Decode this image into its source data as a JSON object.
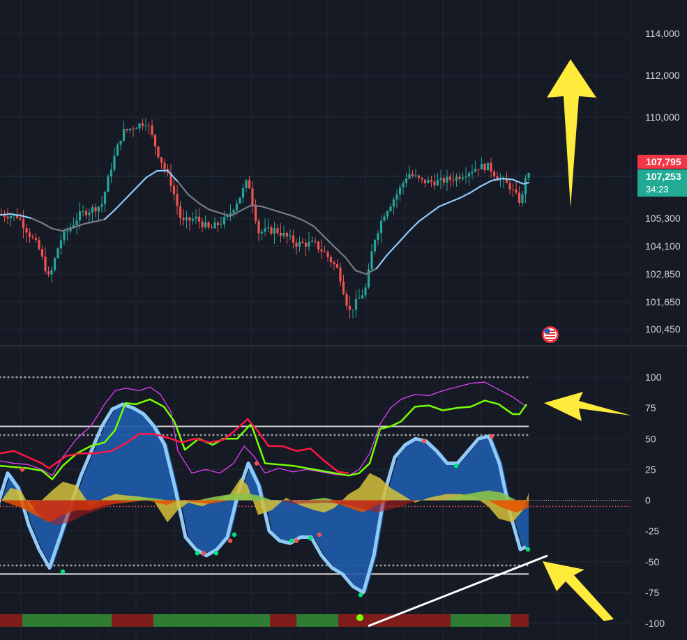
{
  "chart_data": [
    {
      "type": "candlestick",
      "price_axis": {
        "ticks": [
          "114,000",
          "112,000",
          "110,000",
          "105,300",
          "104,100",
          "102,850",
          "101,650",
          "100,450"
        ],
        "tick_values": [
          114000,
          112000,
          110000,
          105300,
          104100,
          102850,
          101650,
          100450
        ]
      },
      "last_high_label": "107,795",
      "last_price_label": "107,253",
      "countdown_label": "34:23",
      "last_price": 107253,
      "last_high": 107795,
      "colors": {
        "up": "#26a69a",
        "down": "#ef5350",
        "ma_light": "#90caf9",
        "ma_gray": "#787b86",
        "annotation": "#ffeb3b"
      },
      "moving_average": [
        [
          0,
          105450
        ],
        [
          15,
          105500
        ],
        [
          30,
          105420
        ],
        [
          45,
          105300
        ],
        [
          60,
          105100
        ],
        [
          75,
          104850
        ],
        [
          90,
          104750
        ],
        [
          105,
          104900
        ],
        [
          120,
          105050
        ],
        [
          135,
          105150
        ],
        [
          150,
          105250
        ],
        [
          165,
          105700
        ],
        [
          180,
          106200
        ],
        [
          195,
          106700
        ],
        [
          210,
          107200
        ],
        [
          225,
          107500
        ],
        [
          240,
          107520
        ],
        [
          255,
          107000
        ],
        [
          270,
          106400
        ],
        [
          285,
          106000
        ],
        [
          300,
          105700
        ],
        [
          315,
          105550
        ],
        [
          330,
          105400
        ],
        [
          345,
          105650
        ],
        [
          360,
          105900
        ],
        [
          375,
          105850
        ],
        [
          390,
          105700
        ],
        [
          405,
          105550
        ],
        [
          420,
          105400
        ],
        [
          435,
          105200
        ],
        [
          450,
          104950
        ],
        [
          465,
          104500
        ],
        [
          480,
          104050
        ],
        [
          495,
          103600
        ],
        [
          510,
          103000
        ],
        [
          525,
          102850
        ],
        [
          540,
          103100
        ],
        [
          555,
          103700
        ],
        [
          570,
          104200
        ],
        [
          585,
          104700
        ],
        [
          600,
          105150
        ],
        [
          615,
          105500
        ],
        [
          630,
          105850
        ],
        [
          645,
          106050
        ],
        [
          660,
          106250
        ],
        [
          675,
          106500
        ],
        [
          690,
          106800
        ],
        [
          705,
          107050
        ],
        [
          720,
          107150
        ],
        [
          735,
          107100
        ],
        [
          750,
          106900
        ],
        [
          758,
          106950
        ]
      ],
      "ma_gray_segments": [
        [
          50,
          155
        ],
        [
          255,
          540
        ]
      ],
      "candles_note_hidden": ""
    },
    {
      "type": "line",
      "oscillator_axis": {
        "ticks": [
          "100",
          "75",
          "50",
          "25",
          "0",
          "-25",
          "-50",
          "-75",
          "-100"
        ],
        "tick_values": [
          100,
          75,
          50,
          25,
          0,
          -25,
          -50,
          -75,
          -100
        ]
      },
      "levels": {
        "dotted_upper": 100,
        "dotted_high": 53,
        "solid_high": 60,
        "zero": 0,
        "red_dotted": -5,
        "solid_low": -60,
        "dotted_low": -53
      },
      "series": [
        {
          "color": "#e040fb",
          "values": [
            [
              0,
              32
            ],
            [
              20,
              30
            ],
            [
              40,
              29
            ],
            [
              60,
              25
            ],
            [
              75,
              20
            ],
            [
              90,
              35
            ],
            [
              110,
              50
            ],
            [
              130,
              60
            ],
            [
              150,
              78
            ],
            [
              165,
              89
            ],
            [
              180,
              91
            ],
            [
              200,
              89
            ],
            [
              215,
              92
            ],
            [
              230,
              86
            ],
            [
              245,
              72
            ],
            [
              255,
              40
            ],
            [
              275,
              22
            ],
            [
              295,
              25
            ],
            [
              315,
              22
            ],
            [
              335,
              30
            ],
            [
              350,
              44
            ],
            [
              365,
              35
            ],
            [
              380,
              22
            ],
            [
              400,
              26
            ],
            [
              420,
              23
            ],
            [
              440,
              25
            ],
            [
              460,
              23
            ],
            [
              480,
              21
            ],
            [
              500,
              20
            ],
            [
              515,
              25
            ],
            [
              530,
              38
            ],
            [
              545,
              62
            ],
            [
              560,
              75
            ],
            [
              575,
              82
            ],
            [
              595,
              86
            ],
            [
              615,
              85
            ],
            [
              635,
              89
            ],
            [
              655,
              92
            ],
            [
              675,
              95
            ],
            [
              695,
              96
            ],
            [
              715,
              90
            ],
            [
              735,
              84
            ],
            [
              755,
              76
            ]
          ]
        },
        {
          "color": "#76ff03",
          "values": [
            [
              0,
              28
            ],
            [
              20,
              27
            ],
            [
              40,
              26
            ],
            [
              60,
              24
            ],
            [
              75,
              17
            ],
            [
              90,
              28
            ],
            [
              110,
              38
            ],
            [
              130,
              44
            ],
            [
              150,
              47
            ],
            [
              165,
              57
            ],
            [
              180,
              79
            ],
            [
              195,
              78
            ],
            [
              215,
              82
            ],
            [
              235,
              76
            ],
            [
              250,
              64
            ],
            [
              265,
              41
            ],
            [
              285,
              50
            ],
            [
              305,
              45
            ],
            [
              320,
              50
            ],
            [
              340,
              50
            ],
            [
              360,
              62
            ],
            [
              380,
              30
            ],
            [
              400,
              29
            ],
            [
              420,
              28
            ],
            [
              440,
              26
            ],
            [
              460,
              24
            ],
            [
              480,
              22
            ],
            [
              500,
              20
            ],
            [
              515,
              22
            ],
            [
              530,
              30
            ],
            [
              545,
              58
            ],
            [
              560,
              60
            ],
            [
              575,
              64
            ],
            [
              595,
              76
            ],
            [
              615,
              77
            ],
            [
              635,
              73
            ],
            [
              655,
              75
            ],
            [
              675,
              76
            ],
            [
              695,
              81
            ],
            [
              715,
              78
            ],
            [
              735,
              70
            ],
            [
              745,
              70
            ],
            [
              755,
              78
            ]
          ]
        },
        {
          "color": "#ff1744",
          "values": [
            [
              0,
              38
            ],
            [
              20,
              40
            ],
            [
              40,
              35
            ],
            [
              60,
              30
            ],
            [
              70,
              26
            ],
            [
              80,
              30
            ],
            [
              95,
              36
            ],
            [
              115,
              38
            ],
            [
              135,
              38
            ],
            [
              160,
              40
            ],
            [
              180,
              46
            ],
            [
              200,
              54
            ],
            [
              220,
              54
            ],
            [
              245,
              50
            ],
            [
              260,
              47
            ],
            [
              280,
              50
            ],
            [
              300,
              47
            ],
            [
              320,
              49
            ],
            [
              340,
              58
            ],
            [
              355,
              66
            ],
            [
              370,
              56
            ],
            [
              385,
              44
            ],
            [
              405,
              44
            ],
            [
              425,
              40
            ],
            [
              445,
              42
            ],
            [
              465,
              32
            ],
            [
              485,
              23
            ],
            [
              500,
              22
            ]
          ]
        }
      ],
      "areas": [
        {
          "color": "#1e5aa8",
          "label": ""
        },
        {
          "color": "#d4c13a",
          "label": ""
        },
        {
          "color": "#e65100",
          "label": ""
        },
        {
          "color": "#8bc34a",
          "label": ""
        }
      ],
      "histogram": [
        [
          0,
          -5
        ],
        [
          15,
          22
        ],
        [
          30,
          10
        ],
        [
          45,
          -20
        ],
        [
          60,
          -40
        ],
        [
          75,
          -55
        ],
        [
          90,
          -30
        ],
        [
          105,
          -5
        ],
        [
          120,
          20
        ],
        [
          135,
          40
        ],
        [
          150,
          60
        ],
        [
          165,
          74
        ],
        [
          180,
          78
        ],
        [
          195,
          75
        ],
        [
          210,
          70
        ],
        [
          225,
          60
        ],
        [
          240,
          45
        ],
        [
          255,
          10
        ],
        [
          270,
          -30
        ],
        [
          285,
          -40
        ],
        [
          300,
          -45
        ],
        [
          315,
          -40
        ],
        [
          330,
          -30
        ],
        [
          345,
          5
        ],
        [
          360,
          30
        ],
        [
          375,
          12
        ],
        [
          390,
          -25
        ],
        [
          405,
          -33
        ],
        [
          420,
          -35
        ],
        [
          435,
          -30
        ],
        [
          450,
          -30
        ],
        [
          465,
          -45
        ],
        [
          480,
          -55
        ],
        [
          495,
          -60
        ],
        [
          510,
          -70
        ],
        [
          525,
          -75
        ],
        [
          540,
          -45
        ],
        [
          555,
          5
        ],
        [
          570,
          35
        ],
        [
          585,
          45
        ],
        [
          600,
          50
        ],
        [
          615,
          48
        ],
        [
          630,
          40
        ],
        [
          645,
          30
        ],
        [
          660,
          30
        ],
        [
          675,
          40
        ],
        [
          690,
          50
        ],
        [
          705,
          52
        ],
        [
          720,
          30
        ],
        [
          735,
          -10
        ],
        [
          750,
          -40
        ],
        [
          758,
          -38
        ]
      ],
      "status_bar": [
        [
          "#7f1c1c",
          0,
          32
        ],
        [
          "#2e7d32",
          32,
          160
        ],
        [
          "#7f1c1c",
          160,
          220
        ],
        [
          "#2e7d32",
          220,
          277
        ],
        [
          "#7f1c1c",
          277,
          277
        ],
        [
          "#2e7d32",
          277,
          387
        ],
        [
          "#7f1c1c",
          387,
          425
        ],
        [
          "#2e7d32",
          425,
          485
        ],
        [
          "#7f1c1c",
          485,
          646
        ],
        [
          "#2e7d32",
          646,
          732
        ],
        [
          "#7f1c1c",
          732,
          758
        ]
      ]
    }
  ]
}
